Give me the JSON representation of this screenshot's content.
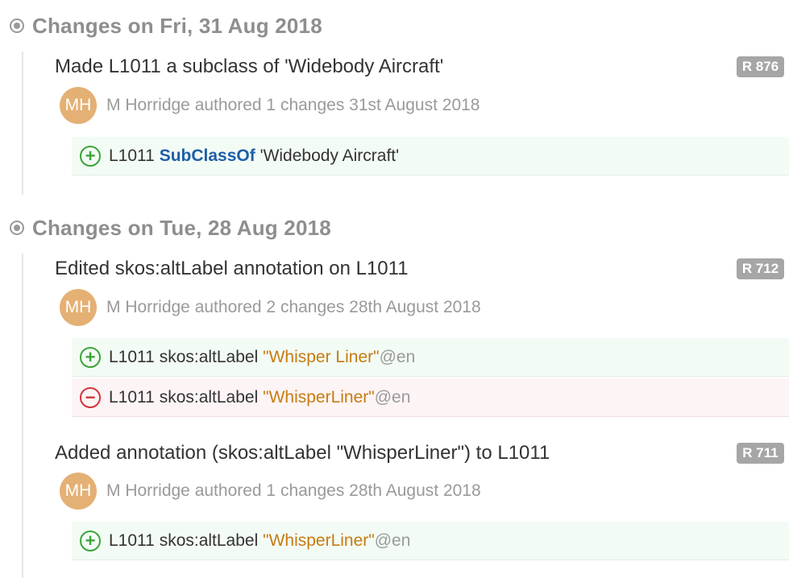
{
  "days": [
    {
      "title": "Changes on Fri, 31 Aug 2018"
    },
    {
      "title": "Changes on Tue, 28 Aug 2018"
    }
  ],
  "entries": [
    {
      "title": "Made L1011 a subclass of 'Widebody Aircraft'",
      "revision": "R 876",
      "avatar_initials": "MH",
      "author_line": "M Horridge authored 1 changes 31st August 2018",
      "changes": [
        {
          "type": "add",
          "subject": "L1011",
          "keyword": "SubClassOf",
          "object": "'Widebody Aircraft'"
        }
      ]
    },
    {
      "title": "Edited skos:altLabel annotation on L1011",
      "revision": "R 712",
      "avatar_initials": "MH",
      "author_line": "M Horridge authored 2 changes 28th August 2018",
      "changes": [
        {
          "type": "add",
          "subject": "L1011",
          "property": "skos:altLabel",
          "literal": "\"Whisper Liner\"",
          "lang": "@en"
        },
        {
          "type": "remove",
          "subject": "L1011",
          "property": "skos:altLabel",
          "literal": "\"WhisperLiner\"",
          "lang": "@en"
        }
      ]
    },
    {
      "title": "Added annotation (skos:altLabel \"WhisperLiner\") to L1011",
      "revision": "R 711",
      "avatar_initials": "MH",
      "author_line": "M Horridge authored 1 changes 28th August 2018",
      "changes": [
        {
          "type": "add",
          "subject": "L1011",
          "property": "skos:altLabel",
          "literal": "\"WhisperLiner\"",
          "lang": "@en"
        }
      ]
    }
  ],
  "colors": {
    "add": "#3aa53a",
    "remove": "#d0343a",
    "keyword": "#1d5fa8",
    "literal": "#c77b12",
    "avatar": "#e4b074",
    "badge": "#a6a6a6"
  },
  "icons": {
    "day_bullet": "timeline-dot-icon",
    "add": "plus-circle-icon",
    "remove": "minus-circle-icon"
  }
}
